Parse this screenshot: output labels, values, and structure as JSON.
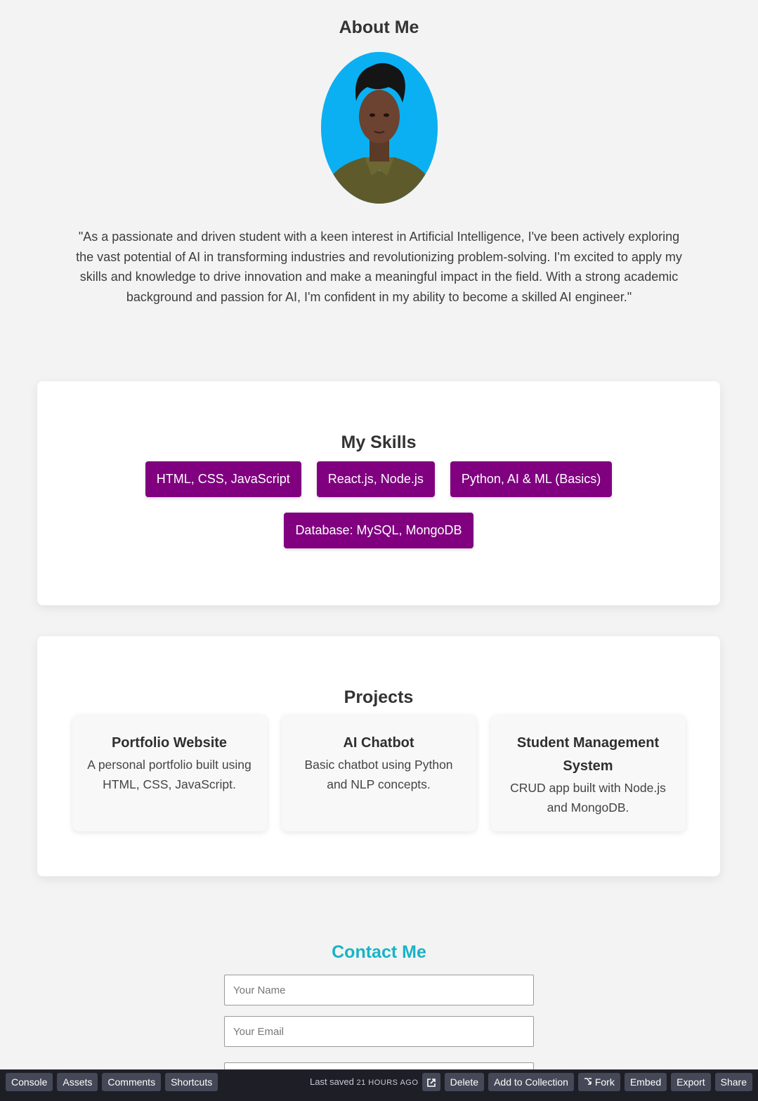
{
  "about": {
    "title": "About Me",
    "bio": "\"As a passionate and driven student with a keen interest in Artificial Intelligence, I've been actively exploring the vast potential of AI in transforming industries and revolutionizing problem-solving. I'm excited to apply my skills and knowledge to drive innovation and make a meaningful impact in the field. With a strong academic background and passion for AI, I'm confident in my ability to become a skilled AI engineer.\""
  },
  "skills": {
    "title": "My Skills",
    "items": [
      "HTML, CSS, JavaScript",
      "React.js, Node.js",
      "Python, AI & ML (Basics)",
      "Database: MySQL, MongoDB"
    ],
    "badge_color": "#800080"
  },
  "projects": {
    "title": "Projects",
    "items": [
      {
        "name": "Portfolio Website",
        "desc": "A personal portfolio built using HTML, CSS, JavaScript."
      },
      {
        "name": "AI Chatbot",
        "desc": "Basic chatbot using Python and NLP concepts."
      },
      {
        "name": "Student Management System",
        "desc": "CRUD app built with Node.js and MongoDB."
      }
    ]
  },
  "contact": {
    "title": "Contact Me",
    "title_color": "#17b4c6",
    "name_placeholder": "Your Name",
    "email_placeholder": "Your Email"
  },
  "editor_bar": {
    "left_buttons": [
      "Console",
      "Assets",
      "Comments",
      "Shortcuts"
    ],
    "saved_label": "Last saved",
    "saved_time": "21 HOURS AGO",
    "external_icon": "external-link-icon",
    "right_buttons": {
      "delete": "Delete",
      "add_to_collection": "Add to Collection",
      "fork": "Fork",
      "embed": "Embed",
      "export": "Export",
      "share": "Share"
    },
    "fork_icon": "fork-icon"
  }
}
